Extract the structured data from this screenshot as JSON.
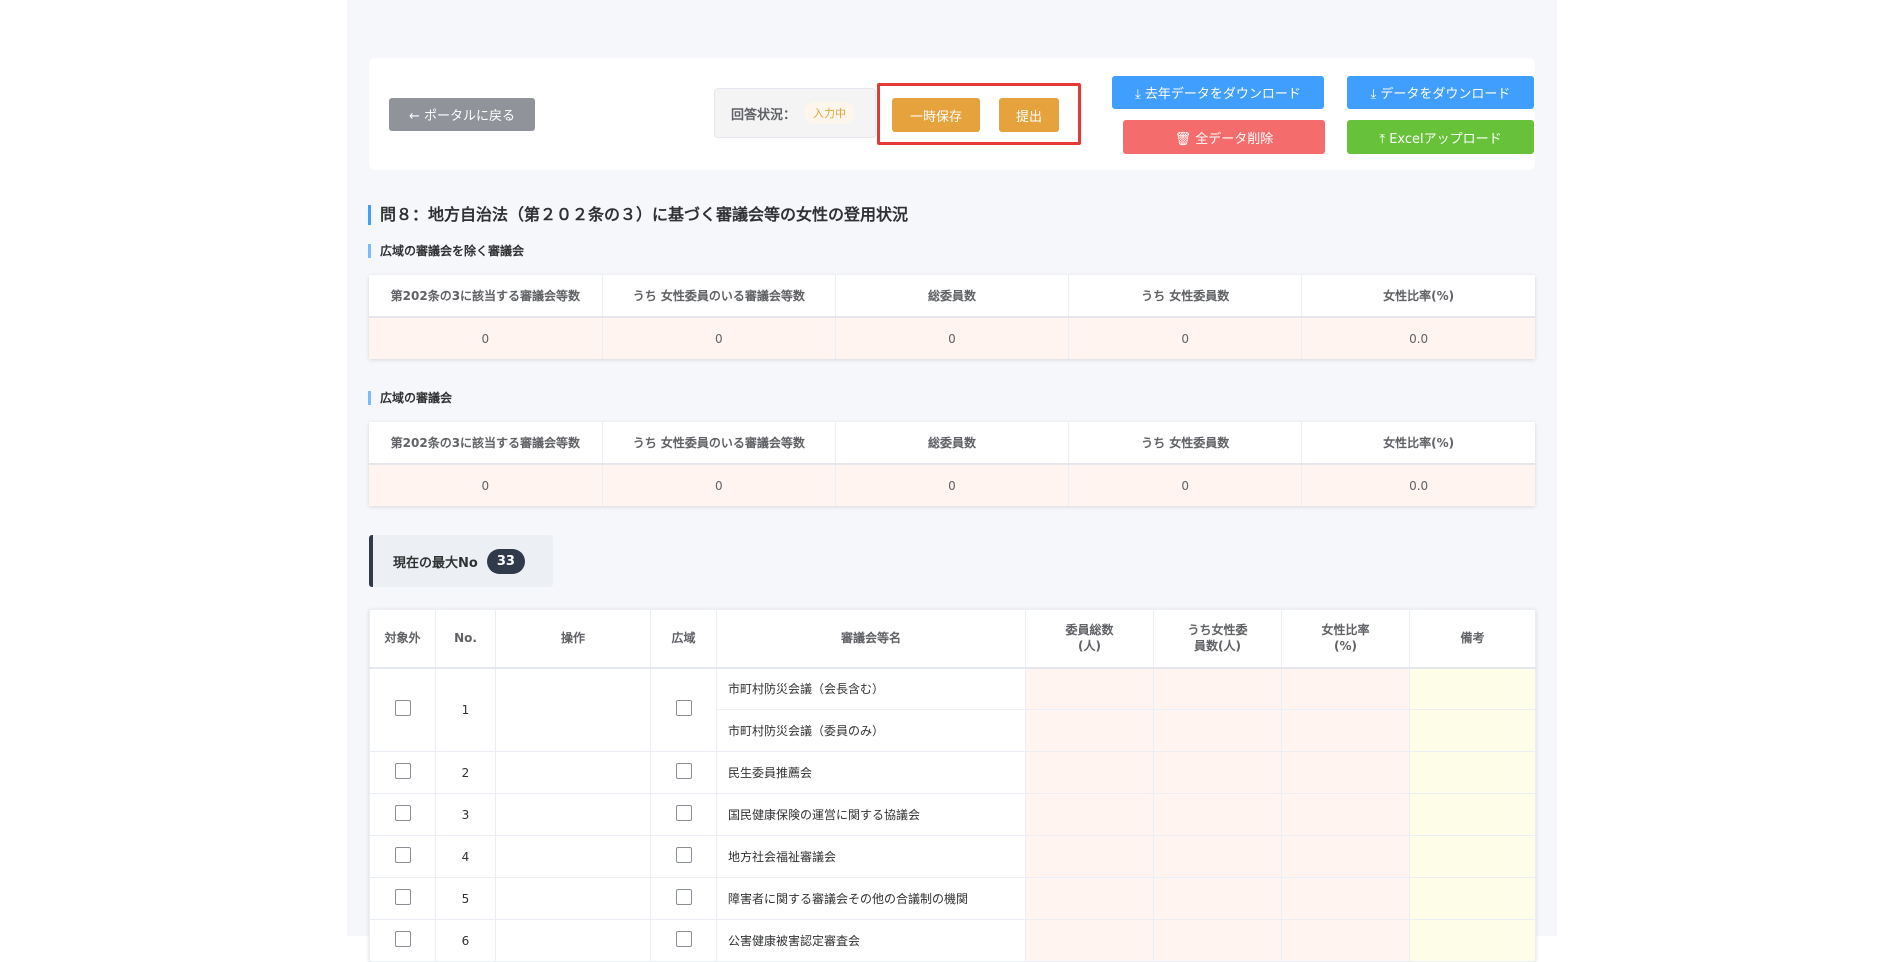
{
  "toolbar": {
    "back_label": "← ポータルに戻る",
    "status_label": "回答状況：",
    "status_value": "入力中",
    "temp_save_label": "一時保存",
    "submit_label": "提出",
    "download_last_year_label": "⤓ 去年データをダウンロード",
    "delete_all_label": "🗑 全データ削除",
    "download_label": "⤓ データをダウンロード",
    "excel_upload_label": "⤒ Excelアップロード"
  },
  "section": {
    "title": "問８：地方自治法（第２０２条の３）に基づく審議会等の女性の登用状況"
  },
  "summary_headers": [
    "第202条の3に該当する審議会等数",
    "うち 女性委員のいる審議会等数",
    "総委員数",
    "うち 女性委員数",
    "女性比率(%)"
  ],
  "summary_tables": [
    {
      "title": "広域の審議会を除く審議会",
      "values": [
        "0",
        "0",
        "0",
        "0",
        "0.0"
      ]
    },
    {
      "title": "広域の審議会",
      "values": [
        "0",
        "0",
        "0",
        "0",
        "0.0"
      ]
    }
  ],
  "max_no": {
    "label": "現在の最大No",
    "value": "33"
  },
  "main_table": {
    "headers": [
      "対象外",
      "No.",
      "操作",
      "広域",
      "審議会等名",
      "委員総数\n(人)",
      "うち女性委\n員数(人)",
      "女性比率\n(%)",
      "備考"
    ],
    "rows": [
      {
        "no": "1",
        "names": [
          "市町村防災会議（会長含む）",
          "市町村防災会議（委員のみ）"
        ]
      },
      {
        "no": "2",
        "names": [
          "民生委員推薦会"
        ]
      },
      {
        "no": "3",
        "names": [
          "国民健康保険の運営に関する協議会"
        ]
      },
      {
        "no": "4",
        "names": [
          "地方社会福祉審議会"
        ]
      },
      {
        "no": "5",
        "names": [
          "障害者に関する審議会その他の合議制の機関"
        ]
      },
      {
        "no": "6",
        "names": [
          "公害健康被害認定審査会"
        ]
      }
    ]
  }
}
